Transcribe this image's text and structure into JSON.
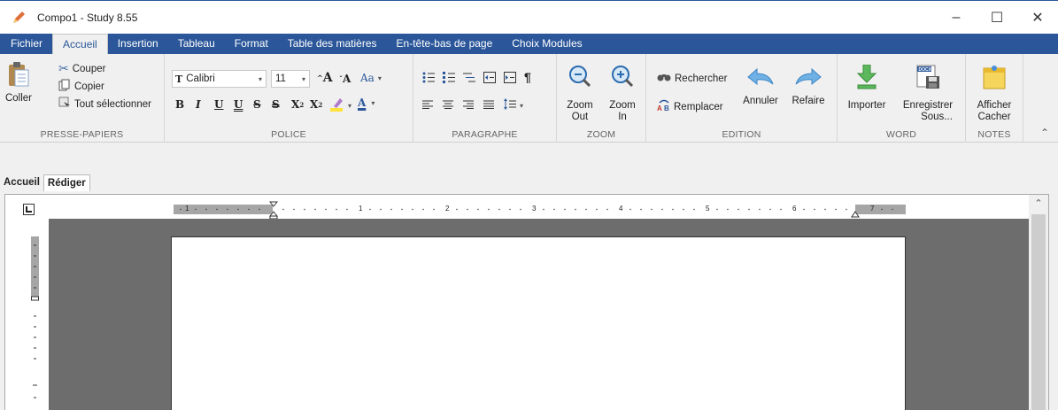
{
  "window": {
    "title": "Compo1 - Study 8.55",
    "minimize": "–",
    "maximize": "☐",
    "close": "✕"
  },
  "menu": {
    "tabs": [
      "Fichier",
      "Accueil",
      "Insertion",
      "Tableau",
      "Format",
      "Table des matières",
      "En-tête-bas de page",
      "Choix Modules"
    ],
    "active_index": 1
  },
  "ribbon": {
    "clipboard": {
      "label": "PRESSE-PAPIERS",
      "paste": "Coller",
      "cut": "Couper",
      "copy": "Copier",
      "select_all": "Tout sélectionner"
    },
    "font": {
      "label": "POLICE",
      "font_name": "Calibri",
      "font_size": "11",
      "grow": "A",
      "shrink": "A",
      "case": "Aa",
      "bold": "B",
      "italic": "I",
      "underline": "U",
      "double_underline": "U",
      "strike": "S",
      "double_strike": "S",
      "subscript": "X",
      "superscript": "X",
      "font_color": "A"
    },
    "paragraph": {
      "label": "PARAGRAPHE",
      "pilcrow": "¶"
    },
    "zoom": {
      "label": "ZOOM",
      "zoom_out": [
        "Zoom",
        "Out"
      ],
      "zoom_in": [
        "Zoom",
        "In"
      ]
    },
    "edition": {
      "label": "EDITION",
      "find": "Rechercher",
      "replace": "Remplacer",
      "undo": "Annuler",
      "redo": "Refaire"
    },
    "word": {
      "label": "WORD",
      "import": "Importer",
      "save_as": [
        "Enregistrer",
        "Sous..."
      ],
      "docx_tag": "DOCX"
    },
    "notes": {
      "label": "NOTES",
      "show_hide": [
        "Afficher",
        "Cacher"
      ]
    }
  },
  "document": {
    "tabs": [
      "Accueil",
      "Rédiger"
    ],
    "active_tab": 1,
    "ruler_numbers": [
      "1",
      "1",
      "2",
      "3",
      "4",
      "5",
      "6",
      "7"
    ]
  },
  "colors": {
    "accent": "#2b579a",
    "ribbon_bg": "#f0f0f0",
    "canvas": "#6d6d6d"
  }
}
